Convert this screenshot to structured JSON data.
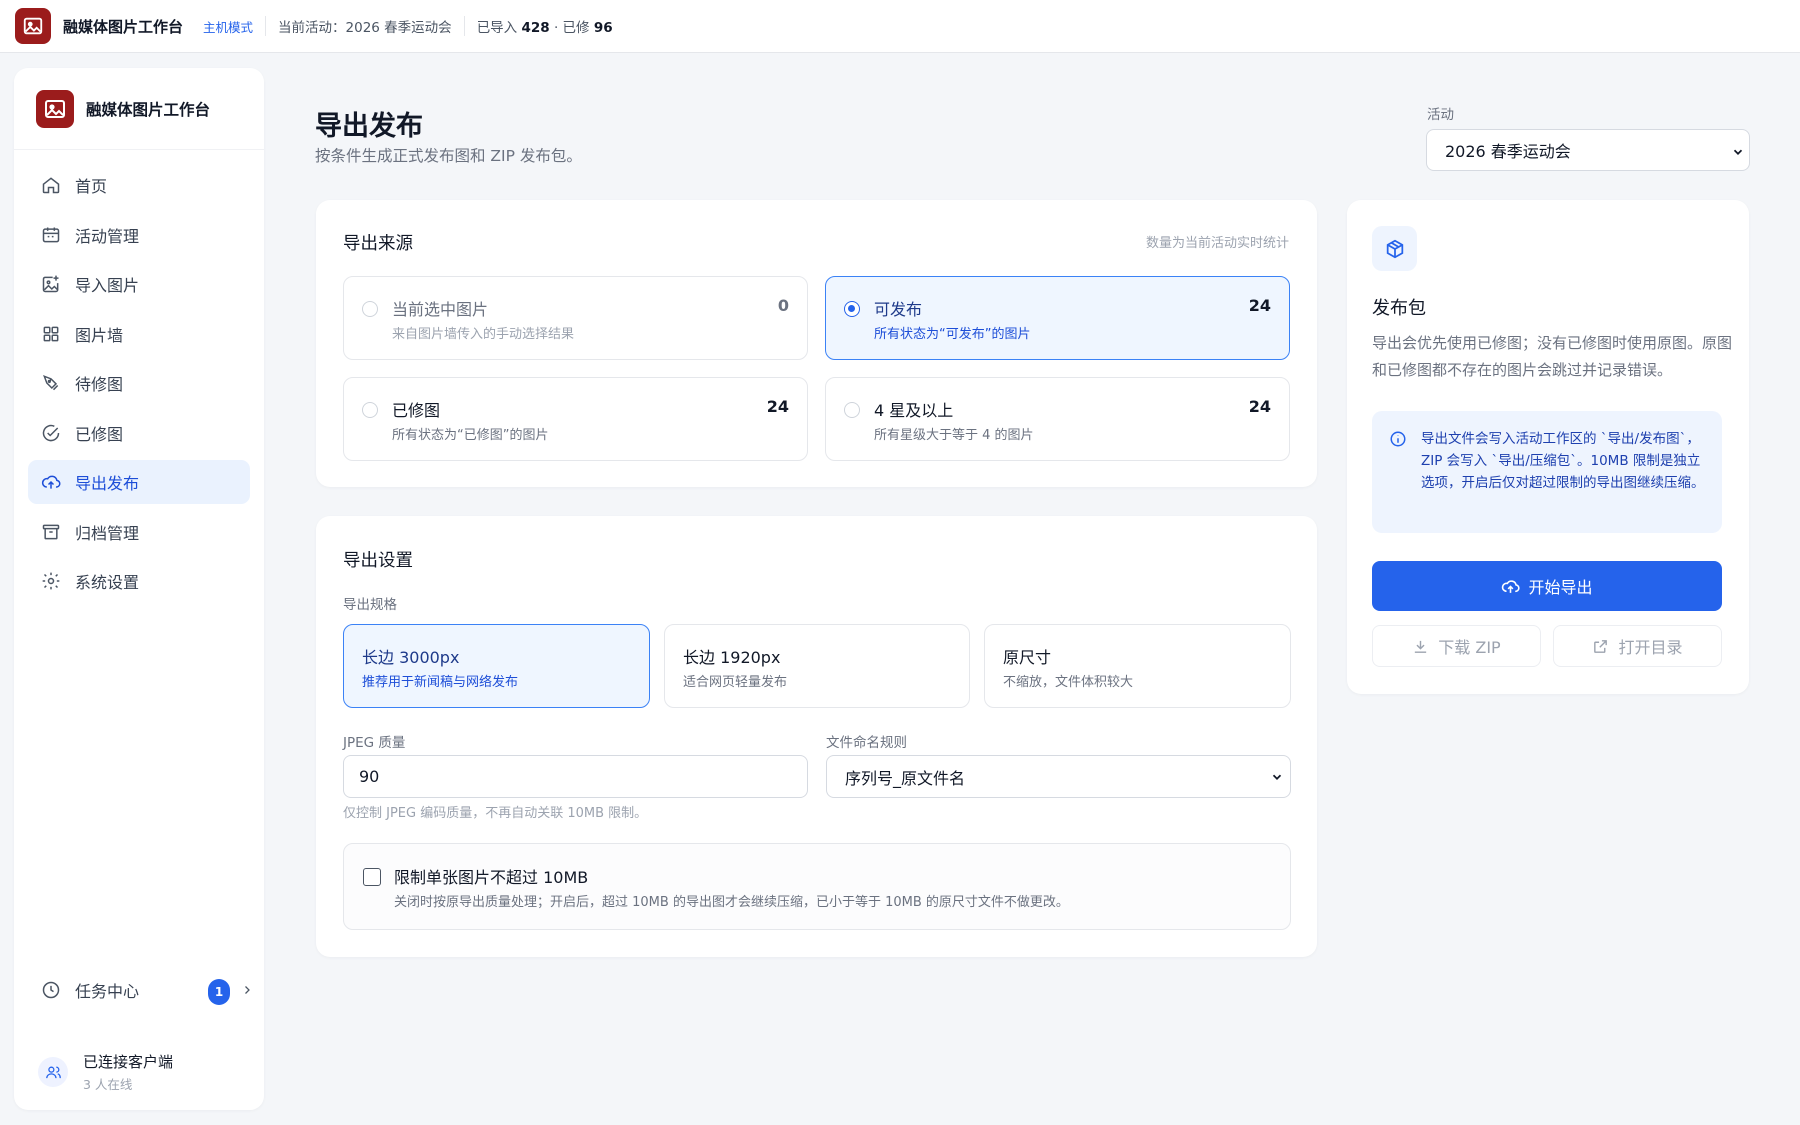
{
  "topbar": {
    "app_title": "融媒体图片工作台",
    "mode": "主机模式",
    "current_activity": "当前活动：2026 春季运动会",
    "imported_label": "已导入",
    "imported_count": "428",
    "edited_label": "· 已修",
    "edited_count": "96"
  },
  "sidebar": {
    "title": "融媒体图片工作台",
    "items": [
      {
        "label": "首页",
        "icon": "home-icon"
      },
      {
        "label": "活动管理",
        "icon": "calendar-icon"
      },
      {
        "label": "导入图片",
        "icon": "image-plus-icon"
      },
      {
        "label": "图片墙",
        "icon": "grid-icon"
      },
      {
        "label": "待修图",
        "icon": "brush-icon"
      },
      {
        "label": "已修图",
        "icon": "check-circle-icon"
      },
      {
        "label": "导出发布",
        "icon": "cloud-upload-icon",
        "active": true
      },
      {
        "label": "归档管理",
        "icon": "archive-icon"
      },
      {
        "label": "系统设置",
        "icon": "gear-icon"
      }
    ],
    "task_center": {
      "label": "任务中心",
      "badge": "1"
    },
    "client": {
      "title": "已连接客户端",
      "subtitle": "3 人在线"
    }
  },
  "page": {
    "title": "导出发布",
    "subtitle": "按条件生成正式发布图和 ZIP 发布包。",
    "activity_label": "活动",
    "activity_value": "2026 春季运动会"
  },
  "source": {
    "heading": "导出来源",
    "hint": "数量为当前活动实时统计",
    "options": [
      {
        "title": "当前选中图片",
        "desc": "来自图片墙传入的手动选择结果",
        "count": "0",
        "state": "disabled"
      },
      {
        "title": "可发布",
        "desc": "所有状态为“可发布”的图片",
        "count": "24",
        "state": "selected"
      },
      {
        "title": "已修图",
        "desc": "所有状态为“已修图”的图片",
        "count": "24",
        "state": "normal"
      },
      {
        "title": "4 星及以上",
        "desc": "所有星级大于等于 4 的图片",
        "count": "24",
        "state": "normal"
      }
    ]
  },
  "settings": {
    "heading": "导出设置",
    "spec_label": "导出规格",
    "specs": [
      {
        "title": "长边 3000px",
        "desc": "推荐用于新闻稿与网络发布",
        "selected": true
      },
      {
        "title": "长边 1920px",
        "desc": "适合网页轻量发布",
        "selected": false
      },
      {
        "title": "原尺寸",
        "desc": "不缩放，文件体积较大",
        "selected": false
      }
    ],
    "jpeg_label": "JPEG 质量",
    "jpeg_value": "90",
    "jpeg_help": "仅控制 JPEG 编码质量，不再自动关联 10MB 限制。",
    "naming_label": "文件命名规则",
    "naming_value": "序列号_原文件名",
    "limit_title": "限制单张图片不超过 10MB",
    "limit_desc": "关闭时按原导出质量处理；开启后，超过 10MB 的导出图才会继续压缩，已小于等于 10MB 的原尺寸文件不做更改。",
    "limit_checked": false
  },
  "package": {
    "title": "发布包",
    "desc": "导出会优先使用已修图；没有已修图时使用原图。原图和已修图都不存在的图片会跳过并记录错误。",
    "info": "导出文件会写入活动工作区的 `导出/发布图`，ZIP 会写入 `导出/压缩包`。10MB 限制是独立选项，开启后仅对超过限制的导出图继续压缩。",
    "start_button": "开始导出",
    "download_button": "下载 ZIP",
    "open_button": "打开目录"
  },
  "colors": {
    "accent": "#2563eb",
    "brand": "#9b1c1c",
    "active_bg": "#eaf2fe"
  }
}
